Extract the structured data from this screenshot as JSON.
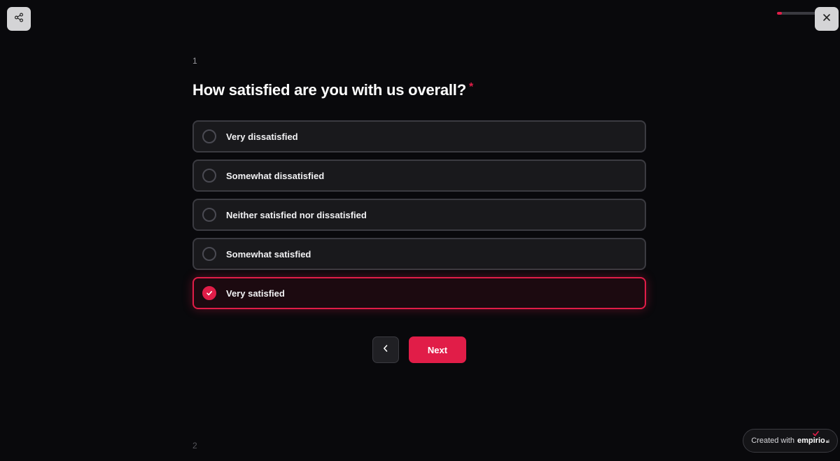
{
  "header": {
    "share_icon": "share-icon",
    "close_icon": "close-icon",
    "progress": 0.12
  },
  "question": {
    "number": "1",
    "title": "How satisfied are you with us overall?",
    "required_mark": "*",
    "options": [
      {
        "label": "Very dissatisfied",
        "selected": false
      },
      {
        "label": "Somewhat dissatisfied",
        "selected": false
      },
      {
        "label": "Neither satisfied nor dissatisfied",
        "selected": false
      },
      {
        "label": "Somewhat satisfied",
        "selected": false
      },
      {
        "label": "Very satisfied",
        "selected": true
      }
    ]
  },
  "navigation": {
    "back_icon": "chevron-left-icon",
    "next_label": "Next"
  },
  "next_question": {
    "number": "2"
  },
  "footer": {
    "created_with": "Created with",
    "brand": "empirio",
    "brand_suffix": "ai"
  },
  "colors": {
    "accent": "#e11d48",
    "background": "#09090c",
    "option_bg": "#19191c",
    "option_border": "#3b3b41"
  }
}
